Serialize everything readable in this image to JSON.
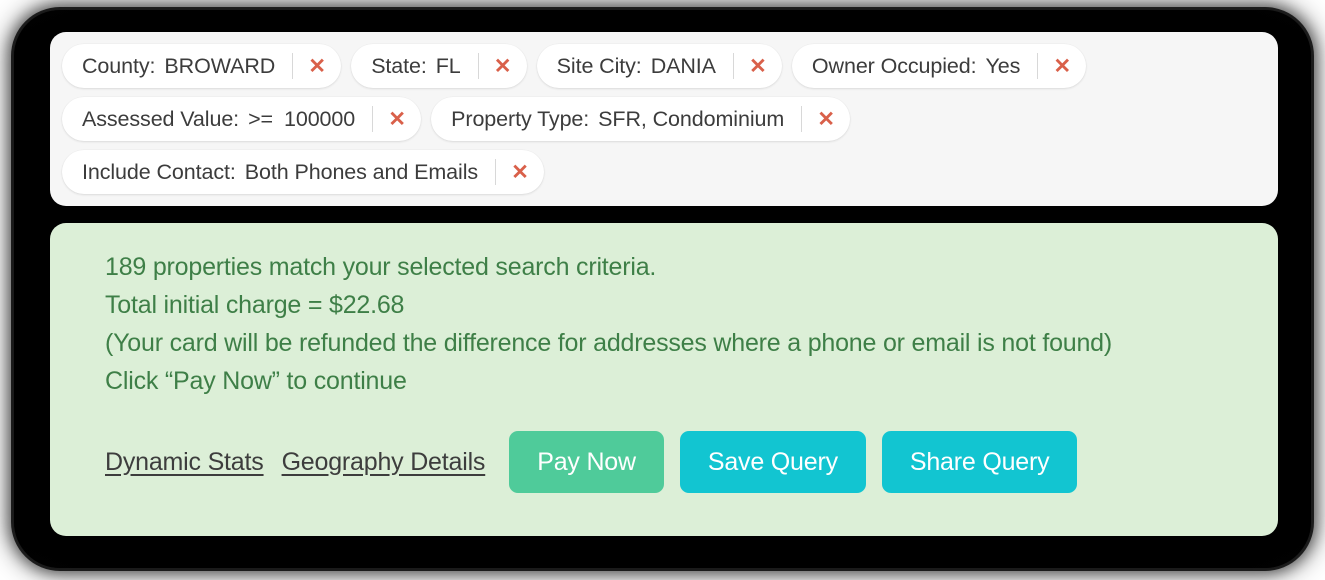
{
  "filters": {
    "chips": [
      {
        "label": "County:",
        "op": "",
        "value": "BROWARD",
        "remove_label": "✕",
        "icon": "close-icon"
      },
      {
        "label": "State:",
        "op": "",
        "value": "FL",
        "remove_label": "✕",
        "icon": "close-icon"
      },
      {
        "label": "Site City:",
        "op": "",
        "value": "DANIA",
        "remove_label": "✕",
        "icon": "close-icon"
      },
      {
        "label": "Owner Occupied:",
        "op": "",
        "value": "Yes",
        "remove_label": "✕",
        "icon": "close-icon"
      },
      {
        "label": "Assessed Value:",
        "op": ">=",
        "value": "100000",
        "remove_label": "✕",
        "icon": "close-icon"
      },
      {
        "label": "Property Type:",
        "op": "",
        "value": "SFR, Condominium",
        "remove_label": "✕",
        "icon": "close-icon"
      },
      {
        "label": "Include Contact:",
        "op": "",
        "value": "Both Phones and Emails",
        "remove_label": "✕",
        "icon": "close-icon"
      }
    ]
  },
  "results": {
    "match_count": 189,
    "lines": [
      "189 properties match your selected search criteria.",
      "Total initial charge = $22.68",
      "(Your card will be refunded the difference for addresses where a phone or email is not found)",
      "Click “Pay Now” to continue"
    ],
    "total_initial_charge": "$22.68",
    "links": [
      {
        "label": "Dynamic Stats"
      },
      {
        "label": "Geography Details"
      }
    ],
    "buttons": [
      {
        "label": "Pay Now",
        "color": "#4fcb9a"
      },
      {
        "label": "Save Query",
        "color": "#12c5d1"
      },
      {
        "label": "Share Query",
        "color": "#12c5d1"
      }
    ]
  },
  "colors": {
    "panel_background": "#dcefd7",
    "panel_text": "#3e7f47",
    "filter_background": "#f6f6f6",
    "chip_background": "#ffffff",
    "chip_text": "#3c3c3c",
    "remove_icon": "#d9604a",
    "pay_now": "#4fcb9a",
    "teal_button": "#12c5d1",
    "link_text": "#3d3d3d",
    "frame": "#0a0a0a"
  }
}
